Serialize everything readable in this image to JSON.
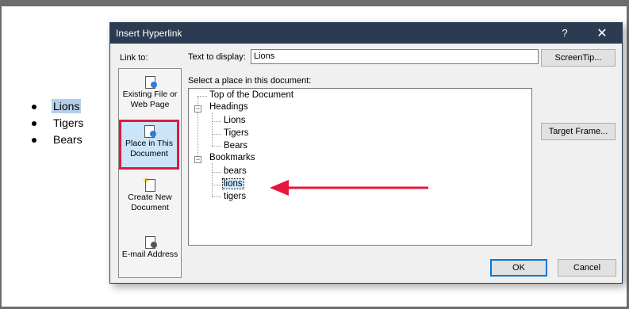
{
  "document": {
    "items": [
      {
        "text": "Lions",
        "selected": true
      },
      {
        "text": "Tigers",
        "selected": false
      },
      {
        "text": "Bears",
        "selected": false
      }
    ]
  },
  "dialog": {
    "title": "Insert Hyperlink",
    "help": "?",
    "close": "✕",
    "link_to_label": "Link to:",
    "link_options": {
      "existing": "Existing File or Web Page",
      "place": "Place in This Document",
      "create": "Create New Document",
      "email": "E-mail Address"
    },
    "text_to_display_label": "Text to display:",
    "text_to_display_value": "Lions",
    "screentip_label": "ScreenTip...",
    "select_place_label": "Select a place in this document:",
    "target_frame_label": "Target Frame...",
    "ok_label": "OK",
    "cancel_label": "Cancel",
    "tree": {
      "top": "Top of the Document",
      "headings": "Headings",
      "heading_items": [
        "Lions",
        "Tigers",
        "Bears"
      ],
      "bookmarks": "Bookmarks",
      "bookmark_items": [
        "bears",
        "lions",
        "tigers"
      ],
      "selected_bookmark": "lions"
    }
  },
  "colors": {
    "titlebar": "#2b3c52",
    "highlight_box": "#d91d3f",
    "arrow": "#e8163a"
  }
}
